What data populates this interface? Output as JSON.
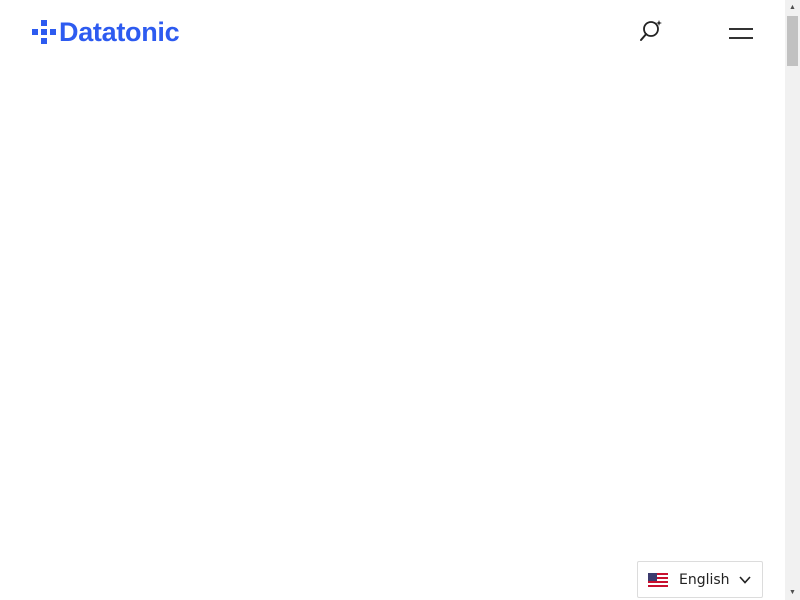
{
  "header": {
    "logo_text": "Datatonic",
    "logo_icon": "plus-cross-logo-icon",
    "search_icon": "magnifier-sparkle-icon",
    "menu_icon": "hamburger-menu-icon"
  },
  "language_switcher": {
    "selected": "English",
    "flag_icon": "us-flag-icon",
    "chevron_icon": "chevron-down-icon"
  },
  "colors": {
    "brand_blue": "#2d5bf0",
    "icon_dark": "#222222",
    "background": "#ffffff"
  }
}
